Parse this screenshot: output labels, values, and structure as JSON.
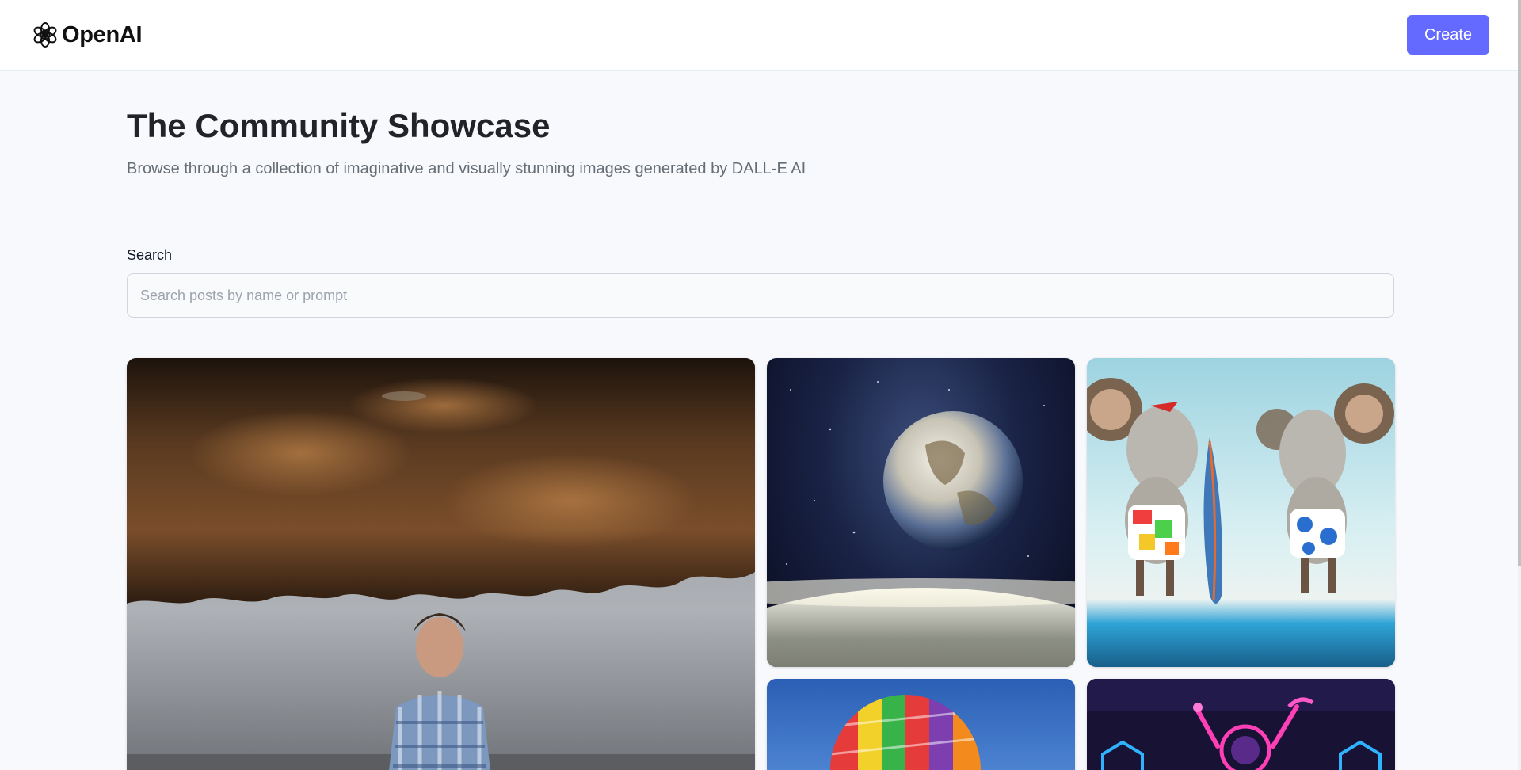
{
  "header": {
    "logo_text": "OpenAI",
    "create_label": "Create"
  },
  "hero": {
    "title": "The Community Showcase",
    "subtitle": "Browse through a collection of imaginative and visually stunning images generated by DALL-E AI"
  },
  "search": {
    "label": "Search",
    "placeholder": "Search posts by name or prompt",
    "value": ""
  },
  "gallery": {
    "items": [
      {
        "subject": "man under rock ceiling"
      },
      {
        "subject": "earth in space"
      },
      {
        "subject": "mice with surfboard"
      },
      {
        "subject": "hot air balloon"
      },
      {
        "subject": "neon astronaut"
      }
    ]
  },
  "colors": {
    "accent": "#6469ff",
    "page_bg": "#f8f9fd",
    "title": "#222328",
    "subtitle": "#666e75"
  }
}
